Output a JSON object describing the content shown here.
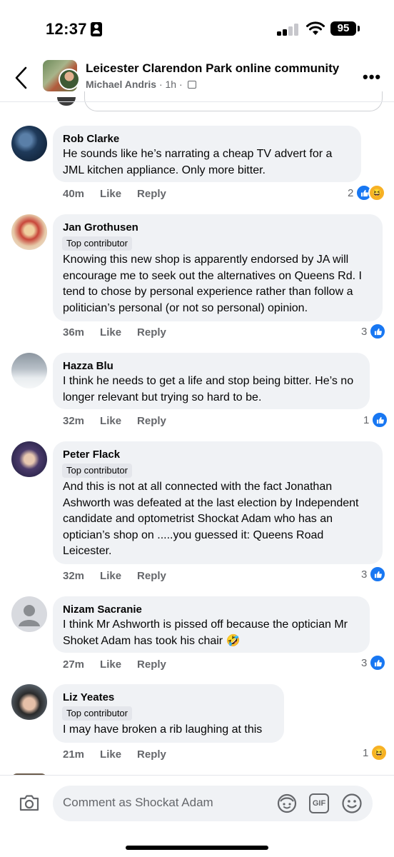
{
  "status_bar": {
    "time": "12:37",
    "battery": "95"
  },
  "header": {
    "group_name": "Leicester Clarendon Park online community",
    "author": "Michael Andris",
    "age": "1h",
    "separator": " · "
  },
  "comments": [
    {
      "name": "Rob Clarke",
      "badge": "",
      "text": "He sounds like he’s narrating a cheap TV advert for a JML kitchen appliance. Only more bitter.",
      "time": "40m",
      "like": "Like",
      "reply": "Reply",
      "reactions": "2",
      "reaction_types": [
        "like-icon",
        "haha-icon"
      ]
    },
    {
      "name": "Jan Grothusen",
      "badge": "Top contributor",
      "text": "Knowing this new shop is apparently endorsed by JA will encourage me to seek out the alternatives on Queens Rd. I tend to chose by personal experience rather than follow a politician’s personal (or not so personal) opinion.",
      "time": "36m",
      "like": "Like",
      "reply": "Reply",
      "reactions": "3",
      "reaction_types": [
        "like-icon"
      ]
    },
    {
      "name": "Hazza Blu",
      "badge": "",
      "text": "I think he needs to get a life and stop being bitter. He’s no longer relevant but trying so hard to be.",
      "time": "32m",
      "like": "Like",
      "reply": "Reply",
      "reactions": "1",
      "reaction_types": [
        "like-icon"
      ]
    },
    {
      "name": "Peter Flack",
      "badge": "Top contributor",
      "text": "And this is not at all connected with the fact Jonathan Ashworth was defeated at the last election by Independent candidate and optometrist Shockat Adam who has an optician’s shop on .....you guessed it: Queens Road Leicester.",
      "time": "32m",
      "like": "Like",
      "reply": "Reply",
      "reactions": "3",
      "reaction_types": [
        "like-icon"
      ]
    },
    {
      "name": "Nizam Sacranie",
      "badge": "",
      "text": "I think Mr Ashworth  is  pissed off because the optician Mr Shoket Adam has took his chair 🤣",
      "time": "27m",
      "like": "Like",
      "reply": "Reply",
      "reactions": "3",
      "reaction_types": [
        "like-icon"
      ]
    },
    {
      "name": "Liz Yeates",
      "badge": "Top contributor",
      "text": "I may have broken a rib laughing at this",
      "time": "21m",
      "like": "Like",
      "reply": "Reply",
      "reactions": "1",
      "reaction_types": [
        "haha-icon"
      ]
    }
  ],
  "composer": {
    "placeholder": "Comment as Shockat Adam",
    "gif_label": "GIF"
  },
  "colors": {
    "accent": "#1877f2",
    "bubble": "#f0f2f5",
    "meta": "#65676b",
    "haha": "#f7b125"
  }
}
